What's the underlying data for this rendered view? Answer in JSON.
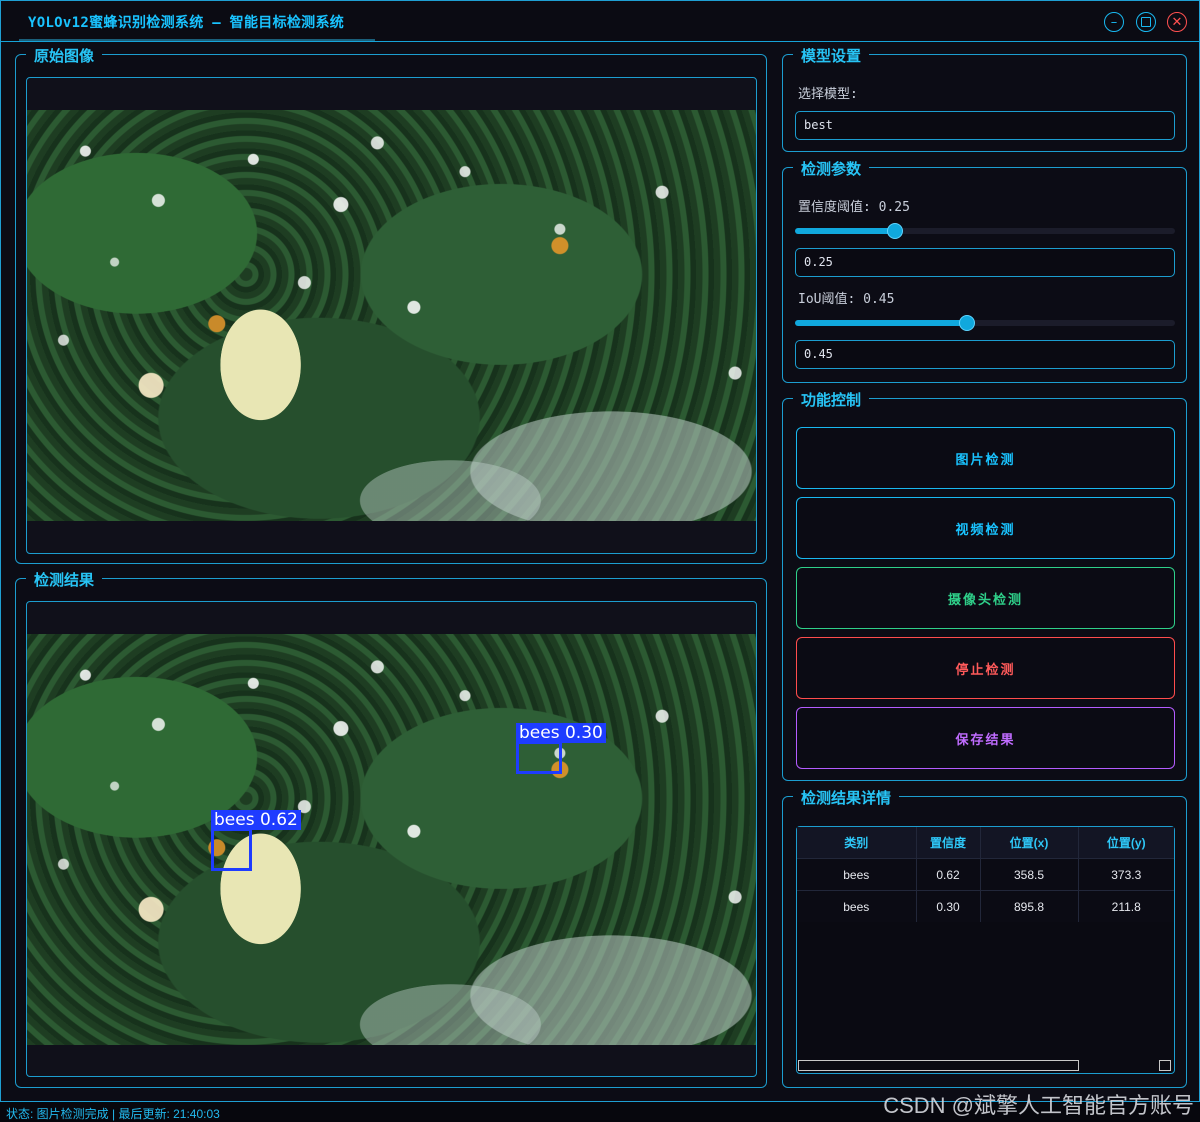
{
  "window": {
    "title": "YOLOv12蜜蜂识别检测系统 – 智能目标检测系统"
  },
  "original_panel": {
    "title": "原始图像"
  },
  "result_panel": {
    "title": "检测结果",
    "detections": [
      {
        "label": "bees 0.62"
      },
      {
        "label": "bees 0.30"
      }
    ]
  },
  "model_settings": {
    "title": "模型设置",
    "select_label": "选择模型:",
    "selected_model": "best"
  },
  "detect_params": {
    "title": "检测参数",
    "confidence_label": "置信度阈值: 0.25",
    "confidence_value": "0.25",
    "iou_label": "IoU阈值: 0.45",
    "iou_value": "0.45"
  },
  "controls": {
    "title": "功能控制",
    "image_detect": "图片检测",
    "video_detect": "视频检测",
    "camera_detect": "摄像头检测",
    "stop_detect": "停止检测",
    "save_result": "保存结果"
  },
  "results_table": {
    "title": "检测结果详情",
    "columns": [
      "类别",
      "置信度",
      "位置(x)",
      "位置(y)"
    ],
    "rows": [
      [
        "bees",
        "0.62",
        "358.5",
        "373.3"
      ],
      [
        "bees",
        "0.30",
        "895.8",
        "211.8"
      ]
    ]
  },
  "status": {
    "text": "状态: 图片检测完成 | 最后更新: 21:40:03"
  },
  "watermark": "CSDN @斌擎人工智能官方账号",
  "colors": {
    "accent": "#19c3ff",
    "border": "#1c9dcf",
    "bbox": "#1e3cff",
    "image_detect": "#19b8f0",
    "video_detect": "#19b8f0",
    "camera_detect": "#2fd08a",
    "stop_detect": "#ff4d4d",
    "save_result": "#b45cff"
  },
  "icons": {
    "minimize": "minimize-icon",
    "maximize": "maximize-icon",
    "close": "close-icon"
  }
}
